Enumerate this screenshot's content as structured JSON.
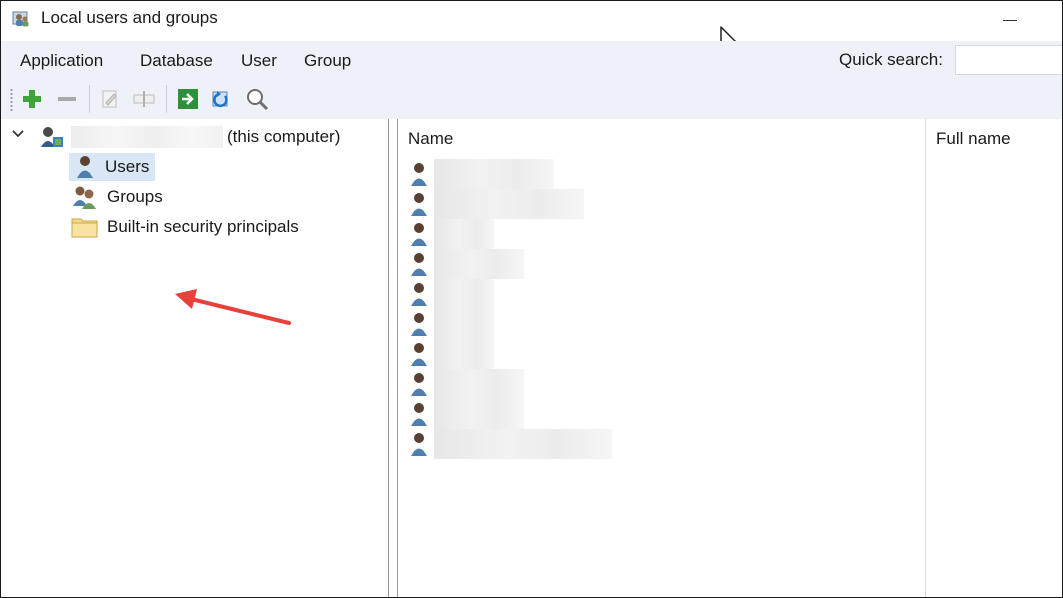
{
  "window": {
    "title": "Local users and groups",
    "icon": "users-group-icon"
  },
  "menu": {
    "items": [
      "Application",
      "Database",
      "User",
      "Group"
    ],
    "quick_search_label": "Quick search:",
    "quick_search_value": ""
  },
  "toolbar": {
    "buttons": [
      "add-icon",
      "remove-icon",
      "edit-icon",
      "rename-icon",
      "export-icon",
      "refresh-icon",
      "search-icon"
    ]
  },
  "tree": {
    "computer_suffix": "(this computer)",
    "items": [
      {
        "label": "Users",
        "icon": "user-icon",
        "selected": true
      },
      {
        "label": "Groups",
        "icon": "group-icon",
        "selected": false
      },
      {
        "label": "Built-in security principals",
        "icon": "folder-icon",
        "selected": false
      }
    ]
  },
  "list": {
    "columns": [
      "Name",
      "Full name"
    ],
    "row_count": 10
  },
  "colors": {
    "menu_bg": "#eef1f8",
    "selection_bg": "#d8e6f5",
    "arrow": "#e8413b"
  }
}
